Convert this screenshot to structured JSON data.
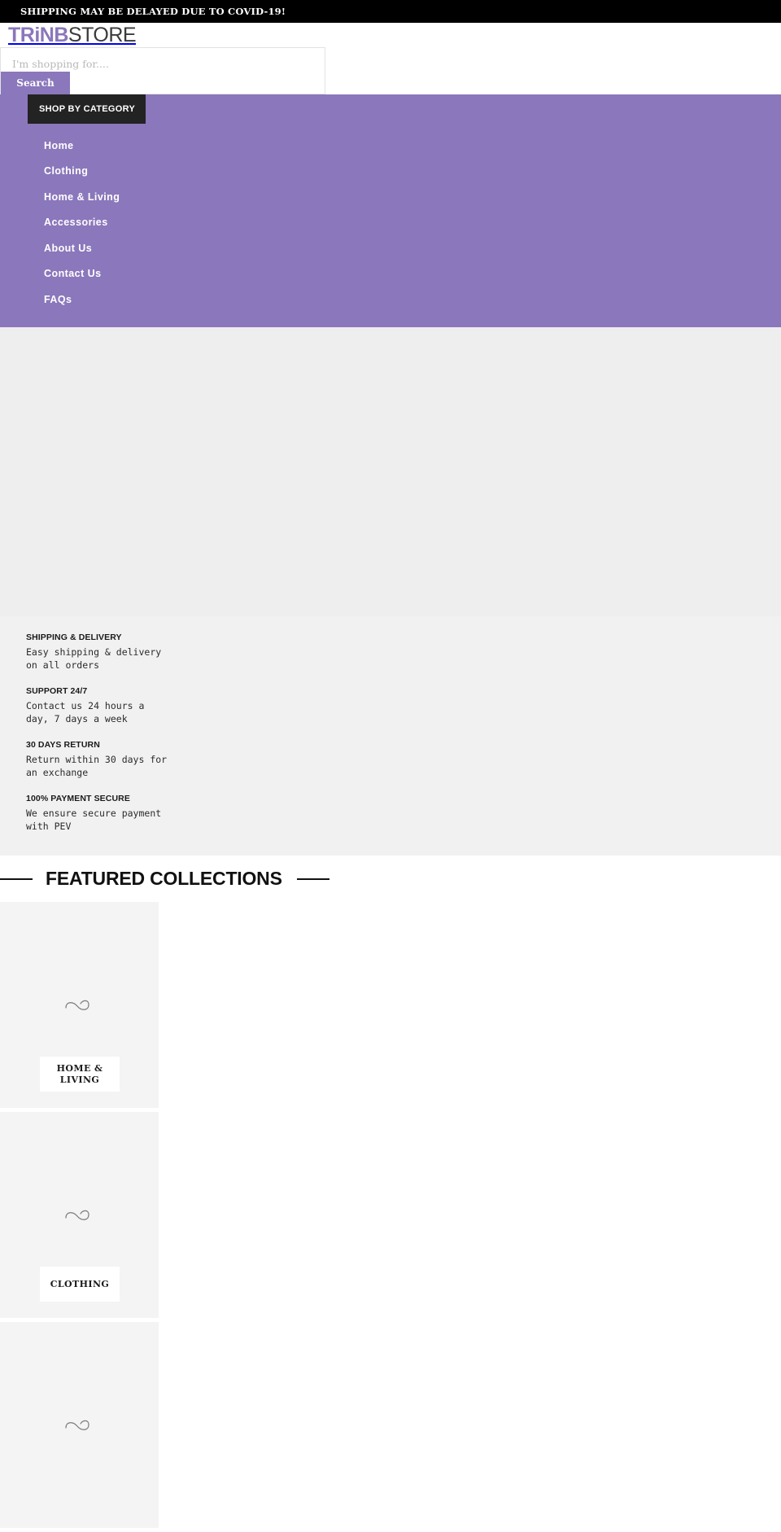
{
  "announcement": {
    "text": "SHIPPING MAY BE DELAYED DUE TO COVID-19!"
  },
  "header": {
    "logo_primary": "TRiNB",
    "logo_secondary": "STORE",
    "brand_color": "#8b77bb"
  },
  "search": {
    "placeholder": "I'm shopping for....",
    "value": "",
    "button_label": "Search"
  },
  "nav": {
    "shop_by_category_label": "SHOP BY CATEGORY",
    "background_color": "#8b77bb",
    "items": [
      {
        "label": "Home"
      },
      {
        "label": "Clothing"
      },
      {
        "label": "Home & Living"
      },
      {
        "label": "Accessories"
      },
      {
        "label": "About Us"
      },
      {
        "label": "Contact Us"
      },
      {
        "label": "FAQs"
      }
    ]
  },
  "features": [
    {
      "title": "SHIPPING & DELIVERY",
      "description": "Easy shipping & delivery on all orders"
    },
    {
      "title": "SUPPORT 24/7",
      "description": "Contact us 24 hours a day, 7 days a week"
    },
    {
      "title": "30 DAYS RETURN",
      "description": "Return within 30 days for an exchange"
    },
    {
      "title": "100% PAYMENT SECURE",
      "description": "We ensure secure payment with PEV"
    }
  ],
  "featured_collections": {
    "heading": "FEATURED COLLECTIONS",
    "cards": [
      {
        "label": "HOME & LIVING",
        "state": "loading"
      },
      {
        "label": "CLOTHING",
        "state": "loading"
      },
      {
        "label": "",
        "state": "loading"
      }
    ]
  }
}
